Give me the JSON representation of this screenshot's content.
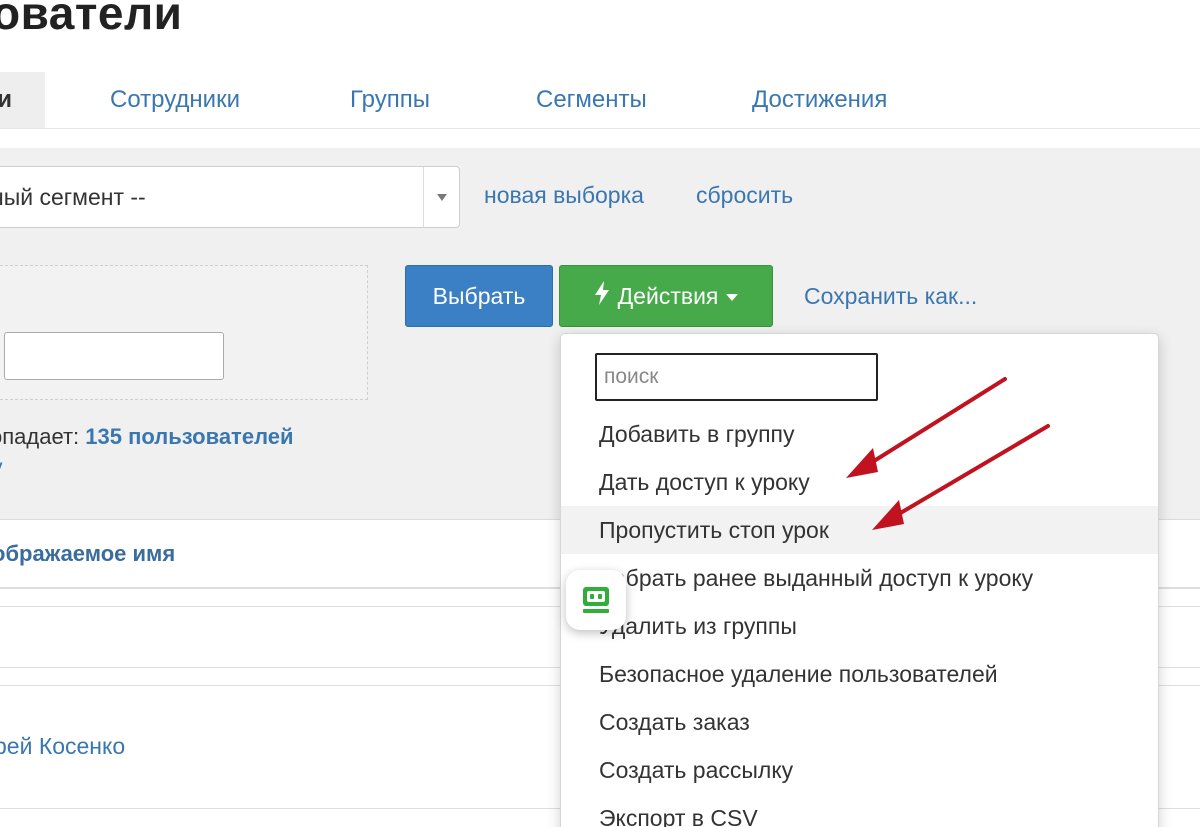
{
  "header": {
    "title": "ователи"
  },
  "tabs": {
    "active": "и",
    "items": [
      "Сотрудники",
      "Группы",
      "Сегменты",
      "Достижения"
    ]
  },
  "filter": {
    "segment_value": "ный сегмент --",
    "new_selection_link": "новая выборка",
    "reset_link": "сбросить",
    "small_input_value": ""
  },
  "buttons": {
    "select": "Выбрать",
    "actions": "Действия",
    "save_as": "Сохранить как..."
  },
  "match": {
    "prefix": "опадает: ",
    "count": "135 пользователей",
    "sub_link": "у"
  },
  "table": {
    "header": "ображаемое имя",
    "rows": [
      "рей Косенко"
    ]
  },
  "dropdown": {
    "search_placeholder": "поиск",
    "items": [
      "Добавить в группу",
      "Дать доступ к уроку",
      "Пропустить стоп урок",
      "Забрать ранее выданный доступ к уроку",
      "Удалить из группы",
      "Безопасное удаление пользователей",
      "Создать заказ",
      "Создать рассылку",
      "Экспорт в CSV"
    ]
  },
  "icons": {
    "bolt": "lightning-bolt-icon",
    "caret": "caret-down-icon",
    "bot": "robot-face-icon",
    "arrow": "red-annotation-arrow"
  },
  "colors": {
    "link_blue": "#3a77b0",
    "button_blue": "#3b7fc4",
    "button_green": "#46a94a",
    "annotation_red": "#c0121f",
    "bot_green": "#2fae3a"
  }
}
